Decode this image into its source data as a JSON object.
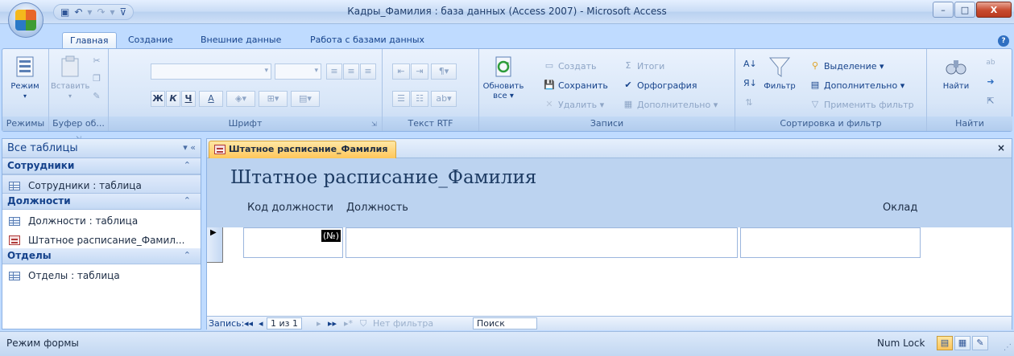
{
  "window": {
    "title": "Кадры_Фамилия : база данных (Access 2007) - Microsoft Access",
    "controls": {
      "minimize": "–",
      "maximize": "□",
      "close": "X"
    }
  },
  "qat": {
    "save_icon": "save-icon",
    "undo_icon": "undo-icon",
    "redo_icon": "redo-icon",
    "customize_icon": "customize-icon"
  },
  "ribbon_tabs": [
    "Главная",
    "Создание",
    "Внешние данные",
    "Работа с базами данных"
  ],
  "ribbon": {
    "groups": {
      "views": "Режимы",
      "clipboard": "Буфер об...",
      "font": "Шрифт",
      "rtf": "Текст RTF",
      "records": "Записи",
      "sort_filter": "Сортировка и фильтр",
      "find": "Найти"
    },
    "buttons": {
      "view": "Режим",
      "paste": "Вставить",
      "refresh_line1": "Обновить",
      "refresh_line2": "все ▾",
      "filter": "Фильтр",
      "find": "Найти",
      "new": "Создать",
      "save": "Сохранить",
      "delete": "Удалить ▾",
      "totals": "Итоги",
      "spelling": "Орфография",
      "more": "Дополнительно ▾",
      "selection": "Выделение ▾",
      "advanced": "Дополнительно ▾",
      "apply_filter": "Применить фильтр"
    },
    "font_buttons": {
      "bold": "Ж",
      "italic": "К",
      "underline": "Ч",
      "font_color": "А"
    }
  },
  "nav_pane": {
    "header": "Все таблицы",
    "header_controls": "▾ «",
    "groups": [
      {
        "name": "Сотрудники",
        "items": [
          {
            "label": "Сотрудники : таблица",
            "type": "table"
          }
        ]
      },
      {
        "name": "Должности",
        "items": [
          {
            "label": "Должности : таблица",
            "type": "table"
          },
          {
            "label": "Штатное расписание_Фамил...",
            "type": "form"
          }
        ]
      },
      {
        "name": "Отделы",
        "items": [
          {
            "label": "Отделы : таблица",
            "type": "table"
          }
        ]
      }
    ],
    "collapse_glyph": "⌃"
  },
  "document": {
    "tab_label": "Штатное расписание_Фамилия",
    "close": "×",
    "form_title": "Штатное расписание_Фамилия",
    "columns": [
      "Код должности",
      "Должность",
      "Оклад"
    ],
    "record": {
      "selector": "▶",
      "code_value": "(№)",
      "position": "",
      "salary": ""
    }
  },
  "record_nav": {
    "label": "Запись:",
    "first": "◂◂",
    "prev": "◂",
    "current": "1 из 1",
    "next": "▸",
    "last": "▸▸",
    "new": "▸*",
    "filter": "Нет фильтра",
    "search": "Поиск"
  },
  "status": {
    "mode": "Режим формы",
    "num_lock": "Num Lock"
  }
}
